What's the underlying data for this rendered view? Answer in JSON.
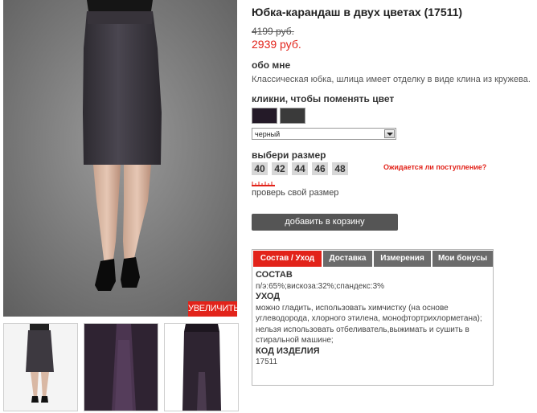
{
  "product": {
    "title": "Юбка-карандаш в двух цветах (17511)",
    "old_price": "4199 руб.",
    "new_price": "2939 руб."
  },
  "about": {
    "heading": "обо мне",
    "text": "Классическая юбка, шлица имеет отделку в виде клина из кружева."
  },
  "colors": {
    "heading": "кликни, чтобы поменять цвет",
    "swatches": [
      "#241a28",
      "#3a3a3a"
    ],
    "selected": "черный"
  },
  "sizes": {
    "heading": "выбери размер",
    "items": [
      "40",
      "42",
      "44",
      "46",
      "48"
    ],
    "wait_link": "Ожидается ли поступление?",
    "check_size": "проверь свой размер"
  },
  "cart": {
    "label": "добавить в корзину"
  },
  "zoom": {
    "label": "УВЕЛИЧИТЬ"
  },
  "tabs": {
    "items": [
      "Состав / Уход",
      "Доставка",
      "Измерения",
      "Мои бонусы"
    ],
    "active": 0
  },
  "details": {
    "composition_h": "СОСТАВ",
    "composition": "п/э:65%;вискоза:32%;спандекс:3%",
    "care_h": "УХОД",
    "care": "можно гладить, использовать химчистку (на основе углеводорода, хлорного этилена, монофтортрихлорметана); нельзя использовать отбеливатель,выжимать и сушить в стиральной машине;",
    "code_h": "КОД ИЗДЕЛИЯ",
    "code": "17511"
  },
  "colors_theme": {
    "accent": "#e2231a",
    "button": "#555555",
    "tab": "#6b6b6b"
  }
}
